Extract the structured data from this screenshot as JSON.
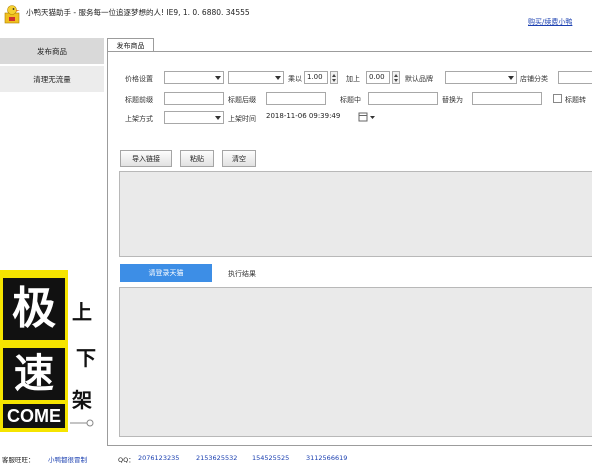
{
  "app": {
    "title": "小鸭天猫助手 - 服务每一位追逐梦想的人! IE9, 1. 0. 6880. 34555",
    "top_link": "购买/续费小鸭"
  },
  "sidebar": {
    "items": [
      {
        "label": "发布商品"
      },
      {
        "label": "清理无流量"
      }
    ]
  },
  "promo": {
    "char1": "极",
    "char2": "速",
    "side1": "上",
    "side2": "下",
    "side3": "架",
    "bottom": "COME"
  },
  "tab": {
    "label": "发布商品"
  },
  "form": {
    "price_label": "价格设置",
    "multiply_label": "乘以",
    "multiply_value": "1.00",
    "add_label": "加上",
    "add_value": "0.00",
    "brand_label": "默认品牌",
    "shop_cat_label": "店铺分类",
    "title_prefix_label": "标题前缀",
    "title_suffix_label": "标题后缀",
    "title_mid_label": "标题中",
    "replace_label": "替换为",
    "title_chk_label": "标题转",
    "listing_label": "上架方式",
    "listing_time_label": "上架时间",
    "listing_time_value": "2018-11-06 09:39:49"
  },
  "buttons": {
    "import": "导入链接",
    "paste": "粘贴",
    "clear": "清空"
  },
  "log": {
    "login_btn": "请登录天猫",
    "result_label": "执行结果"
  },
  "status": {
    "service_label": "客服旺旺：",
    "service_value": "小鸭都很冒制",
    "qq_label": "QQ：",
    "qq_numbers": [
      "2076123235",
      "2153625532",
      "154525525",
      "3112566619"
    ]
  },
  "colors": {
    "accent": "#3d8ee6",
    "promo_yellow": "#f5e400",
    "link": "#1a3fb0"
  }
}
